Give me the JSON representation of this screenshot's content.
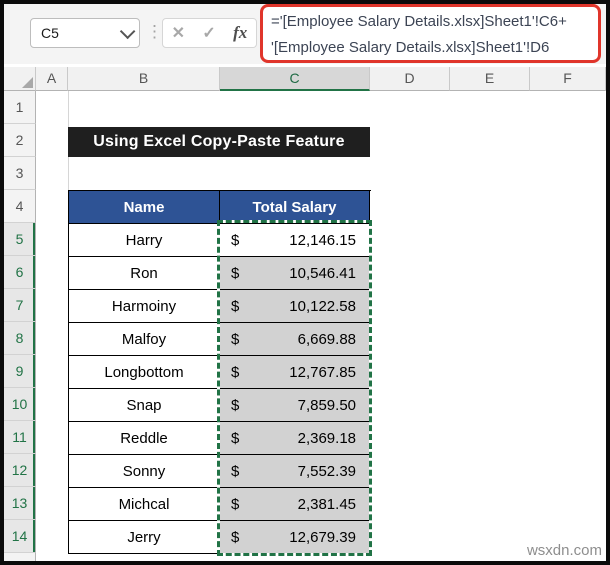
{
  "name_box": {
    "value": "C5"
  },
  "toolbar": {
    "dots_glyph": "⋮",
    "cancel_glyph": "✕",
    "enter_glyph": "✓",
    "fx_label": "fx"
  },
  "formula_bar": {
    "line1": "='[Employee Salary Details.xlsx]Sheet1'!C6+",
    "line2": "'[Employee Salary Details.xlsx]Sheet1'!D6"
  },
  "grid": {
    "columns": [
      "A",
      "B",
      "C",
      "D",
      "E",
      "F"
    ],
    "selected_column": "C",
    "rows": [
      "1",
      "2",
      "3",
      "4",
      "5",
      "6",
      "7",
      "8",
      "9",
      "10",
      "11",
      "12",
      "13",
      "14"
    ],
    "selected_row_start": 5,
    "selected_row_end": 14
  },
  "title_banner": "Using Excel Copy-Paste Feature",
  "table": {
    "headers": [
      "Name",
      "Total Salary"
    ],
    "currency_symbol": "$",
    "data": [
      {
        "name": "Harry",
        "salary": "12,146.15"
      },
      {
        "name": "Ron",
        "salary": "10,546.41"
      },
      {
        "name": "Harmoiny",
        "salary": "10,122.58"
      },
      {
        "name": "Malfoy",
        "salary": "6,669.88"
      },
      {
        "name": "Longbottom",
        "salary": "12,767.85"
      },
      {
        "name": "Snap",
        "salary": "7,859.50"
      },
      {
        "name": "Reddle",
        "salary": "2,369.18"
      },
      {
        "name": "Sonny",
        "salary": "7,552.39"
      },
      {
        "name": "Michcal",
        "salary": "2,381.45"
      },
      {
        "name": "Jerry",
        "salary": "12,679.39"
      }
    ]
  },
  "watermark": "wsxdn.com",
  "colors": {
    "formula_box_border": "#e0352b",
    "table_header_bg": "#2e5395",
    "selection_green": "#217346",
    "selection_fill": "#d2d2d2",
    "banner_bg": "#1f1f1f"
  }
}
